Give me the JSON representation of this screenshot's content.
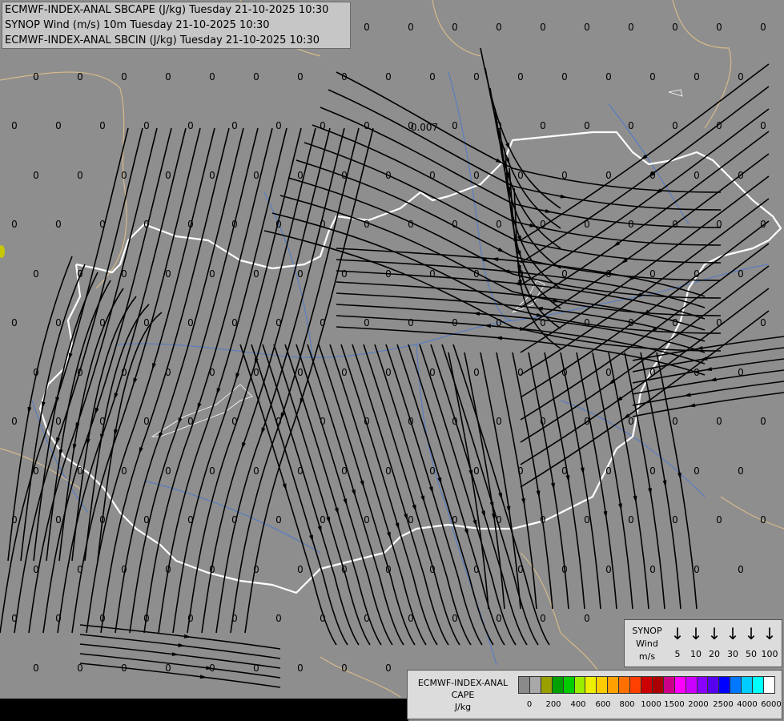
{
  "title_lines": [
    "ECMWF-INDEX-ANAL SBCAPE (J/kg) Tuesday 21-10-2025 10:30",
    "SYNOP Wind (m/s) 10m Tuesday 21-10-2025 10:30",
    "ECMWF-INDEX-ANAL SBCIN (J/kg) Tuesday 21-10-2025 10:30"
  ],
  "synop_legend": {
    "title_lines": [
      "SYNOP",
      "Wind",
      "m/s"
    ],
    "icon": "wind-barb-down-arrow-icon",
    "speeds": [
      "5",
      "10",
      "20",
      "30",
      "50",
      "100"
    ]
  },
  "cape_legend": {
    "title_lines": [
      "ECMWF-INDEX-ANAL",
      "CAPE",
      "J/kg"
    ],
    "colors": [
      "#8a8a8a",
      "#a8a8a8",
      "#9aa000",
      "#00a000",
      "#00cc00",
      "#99ee00",
      "#eeee00",
      "#ffcc00",
      "#ffa000",
      "#ff7000",
      "#ff4000",
      "#cc0000",
      "#aa0000",
      "#cc0088",
      "#ff00ff",
      "#cc00ff",
      "#8800ff",
      "#5500ee",
      "#0000ff",
      "#0077ff",
      "#00ccff",
      "#00ffff",
      "#ffffff"
    ],
    "ticks": [
      "0",
      "200",
      "400",
      "600",
      "800",
      "1000",
      "1500",
      "2000",
      "2500",
      "4000",
      "6000"
    ]
  },
  "colors": {
    "map_background": "#8e8e8e",
    "border_country": "#ffffff",
    "border_neighbor": "#d6b98a",
    "river": "#4f7ac9",
    "streamline": "#000000",
    "small_cape_patch": "#c8c800"
  },
  "grid_value_default": "0",
  "grid_value_special": "0.007"
}
